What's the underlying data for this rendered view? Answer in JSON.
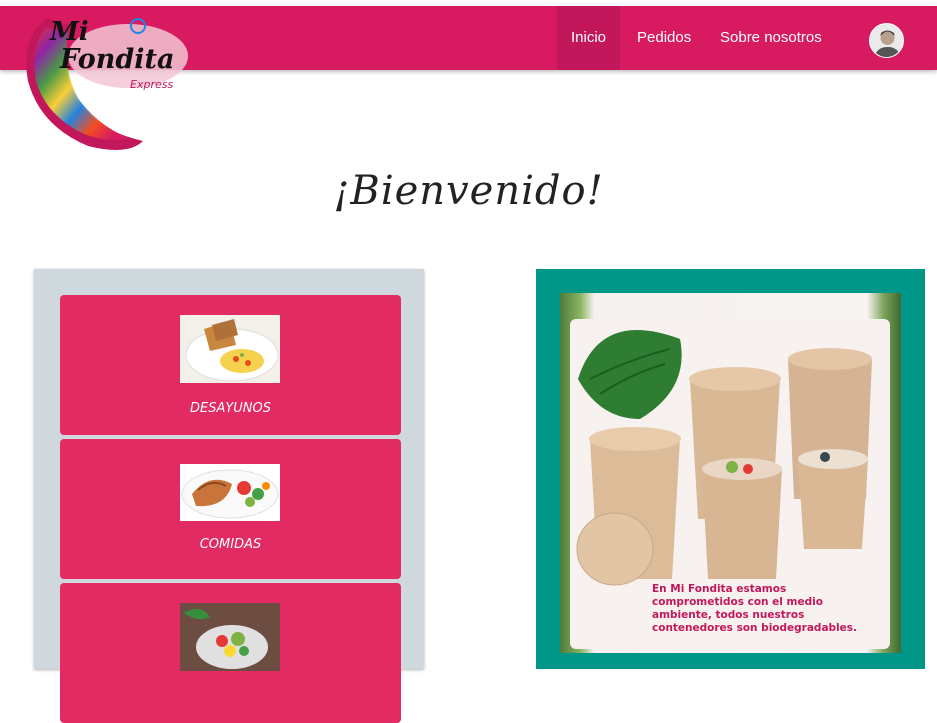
{
  "brand": {
    "logo_line1": "Mi",
    "logo_line2": "Fondita",
    "logo_line3": "Express"
  },
  "nav": {
    "items": [
      {
        "label": "Inicio",
        "active": true
      },
      {
        "label": "Pedidos",
        "active": false
      },
      {
        "label": "Sobre nosotros",
        "active": false
      }
    ]
  },
  "main": {
    "title": "¡Bienvenido!"
  },
  "categories": [
    {
      "label": "DESAYUNOS"
    },
    {
      "label": "COMIDAS"
    }
  ],
  "promo": {
    "text": "En Mi Fondita estamos comprometidos con el medio ambiente, todos nuestros contenedores son biodegradables."
  },
  "colors": {
    "navbar": "#d81b60",
    "nav_active": "#c2185b",
    "card": "#e12b62",
    "left_panel": "#cfd8dc",
    "right_panel": "#009688"
  }
}
